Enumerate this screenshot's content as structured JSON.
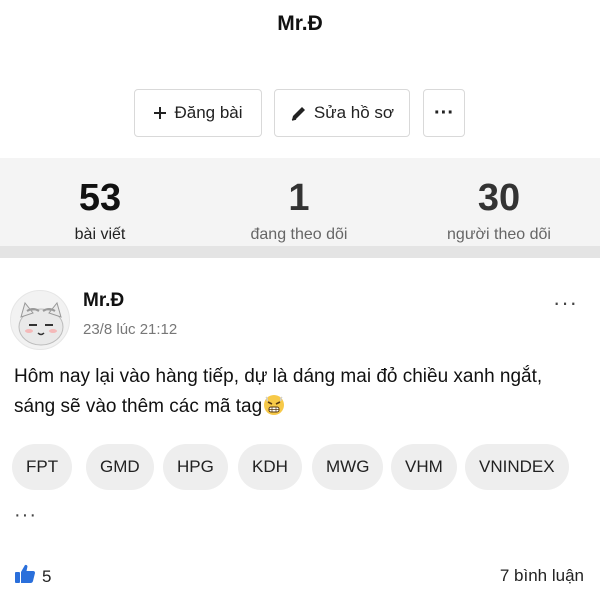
{
  "profile": {
    "name": "Mr.Đ"
  },
  "actions": {
    "post_label": "Đăng bài",
    "edit_label": "Sửa hồ sơ",
    "more_label": "···"
  },
  "stats": [
    {
      "value": "53",
      "label": "bài viết"
    },
    {
      "value": "1",
      "label": "đang theo dõi"
    },
    {
      "value": "30",
      "label": "người theo dõi"
    }
  ],
  "post": {
    "author": "Mr.Đ",
    "time": "23/8 lúc 21:12",
    "menu": "···",
    "content": "Hôm nay lại vào hàng tiếp, dự là dáng mai đỏ chiều xanh ngắt, sáng sẽ vào thêm các mã tag",
    "tags": [
      "FPT",
      "GMD",
      "HPG",
      "KDH",
      "MWG",
      "VHM",
      "VNINDEX"
    ],
    "more": "···",
    "likes": "5",
    "comments": "7 bình luận"
  },
  "icons": {
    "plus": "plus-icon",
    "pencil": "pencil-icon",
    "thumbs_up": "thumbs-up-icon",
    "emoji": "frustrated-face-emoji"
  },
  "colors": {
    "like_blue": "#2a6fdb",
    "stats_bg": "#f4f4f4",
    "tag_bg": "#eeeeee"
  }
}
